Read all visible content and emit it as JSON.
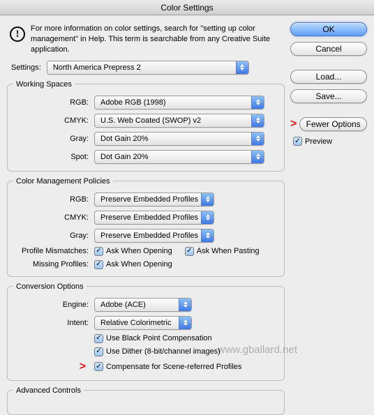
{
  "title": "Color Settings",
  "info": "For more information on color settings, search for \"setting up color management\" in Help. This term is searchable from any Creative Suite application.",
  "settingsLabel": "Settings:",
  "settingsValue": "North America Prepress 2",
  "workingSpaces": {
    "legend": "Working Spaces",
    "labels": {
      "rgb": "RGB:",
      "cmyk": "CMYK:",
      "gray": "Gray:",
      "spot": "Spot:"
    },
    "rgb": "Adobe RGB (1998)",
    "cmyk": "U.S. Web Coated (SWOP) v2",
    "gray": "Dot Gain 20%",
    "spot": "Dot Gain 20%"
  },
  "policies": {
    "legend": "Color Management Policies",
    "labels": {
      "rgb": "RGB:",
      "cmyk": "CMYK:",
      "gray": "Gray:",
      "mismatch": "Profile Mismatches:",
      "missing": "Missing Profiles:"
    },
    "rgb": "Preserve Embedded Profiles",
    "cmyk": "Preserve Embedded Profiles",
    "gray": "Preserve Embedded Profiles",
    "askOpen": "Ask When Opening",
    "askPaste": "Ask When Pasting"
  },
  "conversion": {
    "legend": "Conversion Options",
    "labels": {
      "engine": "Engine:",
      "intent": "Intent:"
    },
    "engine": "Adobe (ACE)",
    "intent": "Relative Colorimetric",
    "useBPC": "Use Black Point Compensation",
    "useDither": "Use Dither (8-bit/channel images)",
    "compensate": "Compensate for Scene-referred Profiles"
  },
  "advanced": {
    "legend": "Advanced Controls"
  },
  "buttons": {
    "ok": "OK",
    "cancel": "Cancel",
    "load": "Load...",
    "save": "Save...",
    "fewer": "Fewer Options",
    "preview": "Preview"
  },
  "watermark": "www.gballard.net"
}
